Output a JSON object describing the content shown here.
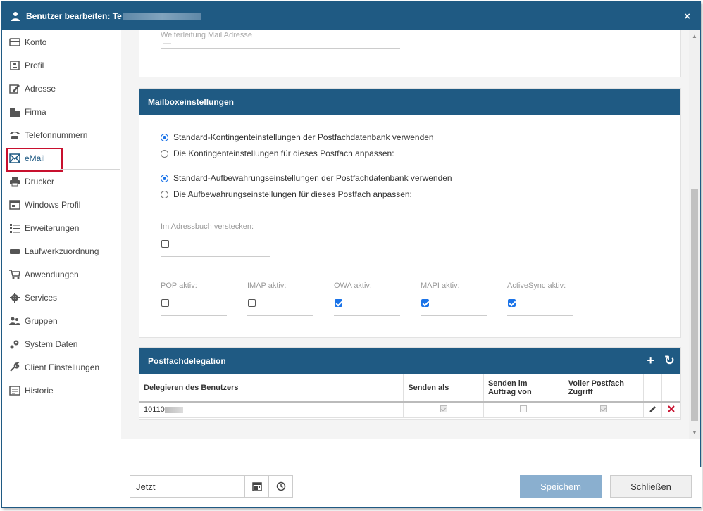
{
  "window": {
    "title": "Benutzer bearbeiten: Te",
    "close_symbol": "×"
  },
  "sidebar": {
    "items": [
      {
        "label": "Konto",
        "icon": "card-icon"
      },
      {
        "label": "Profil",
        "icon": "profile-icon"
      },
      {
        "label": "Adresse",
        "icon": "edit-icon"
      },
      {
        "label": "Firma",
        "icon": "building-icon"
      },
      {
        "label": "Telefonnummern",
        "icon": "phone-icon"
      },
      {
        "label": "eMail",
        "icon": "mail-icon",
        "active": true
      },
      {
        "label": "Drucker",
        "icon": "printer-icon"
      },
      {
        "label": "Windows Profil",
        "icon": "window-icon"
      },
      {
        "label": "Erweiterungen",
        "icon": "list-icon"
      },
      {
        "label": "Laufwerkzuordnung",
        "icon": "drive-icon"
      },
      {
        "label": "Anwendungen",
        "icon": "cart-icon"
      },
      {
        "label": "Services",
        "icon": "gear-icon"
      },
      {
        "label": "Gruppen",
        "icon": "group-icon"
      },
      {
        "label": "System Daten",
        "icon": "system-icon"
      },
      {
        "label": "Client Einstellungen",
        "icon": "wrench-icon"
      },
      {
        "label": "Historie",
        "icon": "history-icon"
      }
    ]
  },
  "forwarding": {
    "label": "Weiterleitung Mail Adresse",
    "value": "—"
  },
  "mailbox": {
    "header": "Mailboxeinstellungen",
    "quota_default": "Standard-Kontingenteinstellungen der Postfachdatenbank verwenden",
    "quota_custom": "Die Kontingenteinstellungen für dieses Postfach anpassen:",
    "retention_default": "Standard-Aufbewahrungseinstellungen der Postfachdatenbank verwenden",
    "retention_custom": "Die Aufbewahrungseinstellungen für dieses Postfach anpassen:",
    "hide_label": "Im Adressbuch verstecken:",
    "protocols": [
      {
        "label": "POP aktiv:",
        "checked": false
      },
      {
        "label": "IMAP aktiv:",
        "checked": false
      },
      {
        "label": "OWA aktiv:",
        "checked": true
      },
      {
        "label": "MAPI aktiv:",
        "checked": true
      },
      {
        "label": "ActiveSync aktiv:",
        "checked": true
      }
    ]
  },
  "delegation": {
    "header": "Postfachdelegation",
    "add_symbol": "+",
    "refresh_symbol": "↻",
    "columns": {
      "user": "Delegieren des Benutzers",
      "send_as": "Senden als",
      "send_on_behalf_1": "Senden im",
      "send_on_behalf_2": "Auftrag von",
      "full_access_1": "Voller Postfach",
      "full_access_2": "Zugriff"
    },
    "rows": [
      {
        "user": "10110",
        "send_as": true,
        "send_on_behalf": false,
        "full_access": true
      }
    ]
  },
  "footer": {
    "date_value": "Jetzt",
    "save": "Speichem",
    "close": "Schließen"
  }
}
